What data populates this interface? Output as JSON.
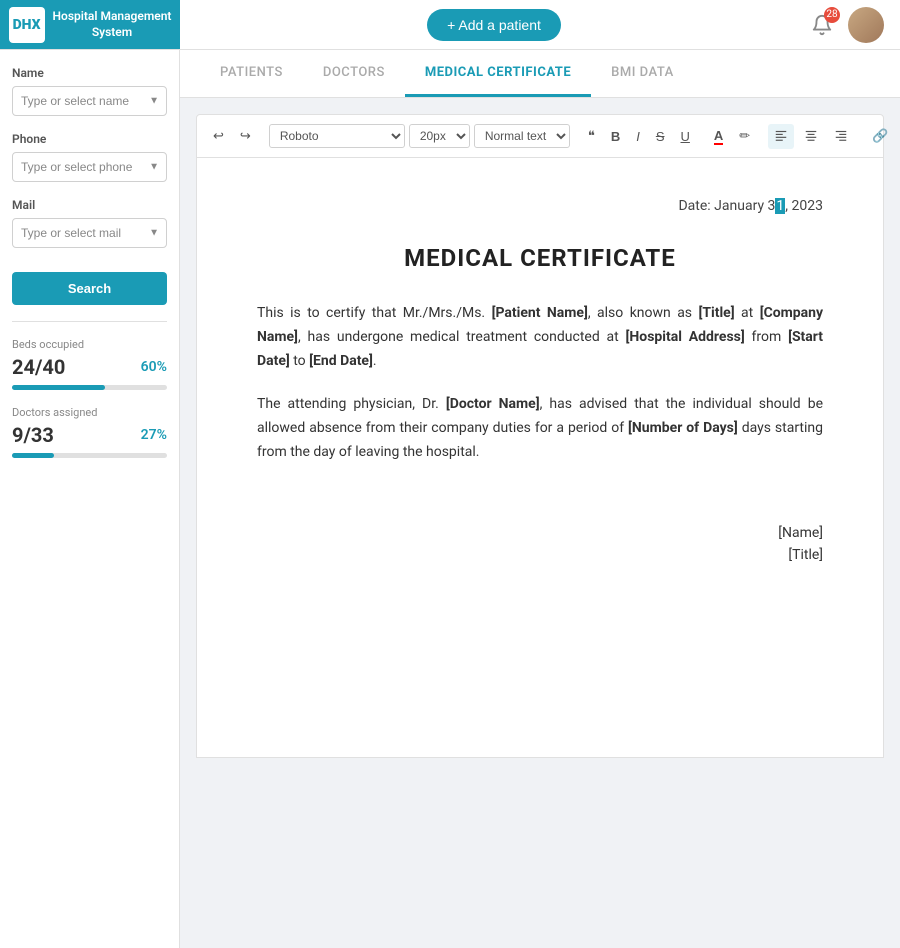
{
  "app": {
    "logo_text1": "DHX",
    "logo_text2": "Hospital Management\nSystem",
    "add_patient_label": "+ Add a patient",
    "notification_count": "28"
  },
  "tabs": [
    {
      "id": "patients",
      "label": "PATIENTS",
      "active": false
    },
    {
      "id": "doctors",
      "label": "DOCTORS",
      "active": false
    },
    {
      "id": "medical-certificate",
      "label": "MEDICAL CERTIFICATE",
      "active": true
    },
    {
      "id": "bmi-data",
      "label": "BMI DATA",
      "active": false
    }
  ],
  "sidebar": {
    "name_label": "Name",
    "name_placeholder": "Type or select name",
    "phone_label": "Phone",
    "phone_placeholder": "Type or select phone",
    "mail_label": "Mail",
    "mail_placeholder": "Type or select mail",
    "search_label": "Search"
  },
  "stats": [
    {
      "label": "Beds occupied",
      "value": "24/40",
      "percent": "60%",
      "fill_width": "60"
    },
    {
      "label": "Doctors assigned",
      "value": "9/33",
      "percent": "27%",
      "fill_width": "27"
    }
  ],
  "toolbar": {
    "undo_label": "↩",
    "redo_label": "↪",
    "font_value": "Roboto",
    "size_value": "20px",
    "style_value": "Normal text",
    "quote_label": "❝",
    "bold_label": "B",
    "italic_label": "I",
    "strike_label": "S̶",
    "underline_label": "U",
    "font_color_label": "A",
    "highlight_label": "✏",
    "align_left_label": "≡",
    "align_center_label": "≡",
    "align_right_label": "≡",
    "link_label": "🔗",
    "eraser_label": "⌫",
    "fullscreen_label": "⛶"
  },
  "document": {
    "date_label": "Date:",
    "date_value": "January 31, 2023",
    "title": "MEDICAL CERTIFICATE",
    "paragraph1": "This is to certify that Mr./Mrs./Ms. [Patient Name], also known as [Title] at [Company Name], has undergone medical treatment conducted at [Hospital Address] from [Start Date] to [End Date].",
    "paragraph2": "The attending physician, Dr. [Doctor Name], has advised that the individual should be allowed absence from their company duties for a period of [Number of Days] days starting from the day of leaving the hospital.",
    "signature_name": "[Name]",
    "signature_title": "[Title]"
  }
}
